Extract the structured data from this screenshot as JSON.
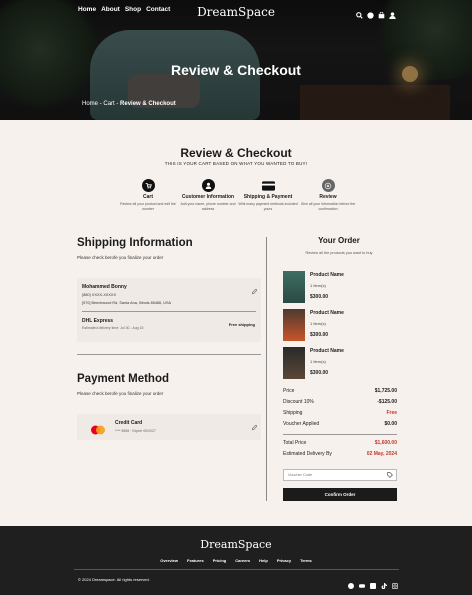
{
  "nav": {
    "links": [
      "Home",
      "About",
      "Shop",
      "Contact"
    ],
    "logo": "DreamSpace",
    "icons": [
      "search-icon",
      "chat-icon",
      "cart-icon",
      "user-icon"
    ]
  },
  "hero": {
    "title": "Review & Checkout",
    "breadcrumb": {
      "home": "Home",
      "cart": "Cart",
      "current": "Review & Checkout"
    }
  },
  "section": {
    "title": "Review & Checkout",
    "subtitle": "THIS IS YOUR CART BASED ON WHAT YOU WANTED TO BUY!"
  },
  "steps": [
    {
      "title": "Cart",
      "desc": "Review all your product and edit the number"
    },
    {
      "title": "Customer Information",
      "desc": "Add your name, phone number and address"
    },
    {
      "title": "Shipping & Payment",
      "desc": "Whit many payment methods included yours"
    },
    {
      "title": "Review",
      "desc": "Give all your information before the confirmation"
    }
  ],
  "shipping": {
    "title": "Shipping Information",
    "note": "Please check berofe you finalize your order",
    "name": "Mohammed Bonny",
    "phone": "(880) XXXX-XXXXX",
    "address": "[970] Beechwood Rd, Santa Ana, Illinois 85486, USA",
    "courier": "DHL Express",
    "estimate": "Estimated delivery time: Jul 30 - Aug 15",
    "free": "Free shipping"
  },
  "payment": {
    "title": "Payment Method",
    "note": "Please check berofe you finalize your order",
    "card": "Credit Card",
    "card_number": "**** 9865 · Expire 09/2027"
  },
  "order": {
    "title": "Your Order",
    "subtitle": "Review all the products you want to buy",
    "items": [
      {
        "name": "Product Name",
        "qty": "1 Item(s)",
        "price": "$300.00"
      },
      {
        "name": "Product Name",
        "qty": "1 Item(s)",
        "price": "$300.00"
      },
      {
        "name": "Product Name",
        "qty": "1 Item(s)",
        "price": "$300.00"
      }
    ],
    "price_label": "Price",
    "price": "$1,725.00",
    "discount_label": "Discount 10%",
    "discount": "-$125.00",
    "shipping_label": "Shipping",
    "shipping": "Free",
    "voucher_label": "Voucher Applied",
    "voucher": "$0.00",
    "total_label": "Total Price",
    "total": "$1,600.00",
    "delivery_label": "Estimated Delivery By",
    "delivery": "02 May, 2024",
    "voucher_placeholder": "Voucher Code",
    "confirm": "Confirm Order"
  },
  "footer": {
    "logo": "DreamSpace",
    "links": [
      "Overview",
      "Features",
      "Pricing",
      "Careers",
      "Help",
      "Privacy",
      "Terms"
    ],
    "copyright": "© 2024 Dreamspace. All rights reserved.",
    "socials": [
      "facebook-icon",
      "youtube-icon",
      "linkedin-icon",
      "tiktok-icon",
      "instagram-icon"
    ]
  },
  "colors": {
    "accent": "#c0392b",
    "dark": "#1b1b1b",
    "bg": "#f7f1ed"
  }
}
